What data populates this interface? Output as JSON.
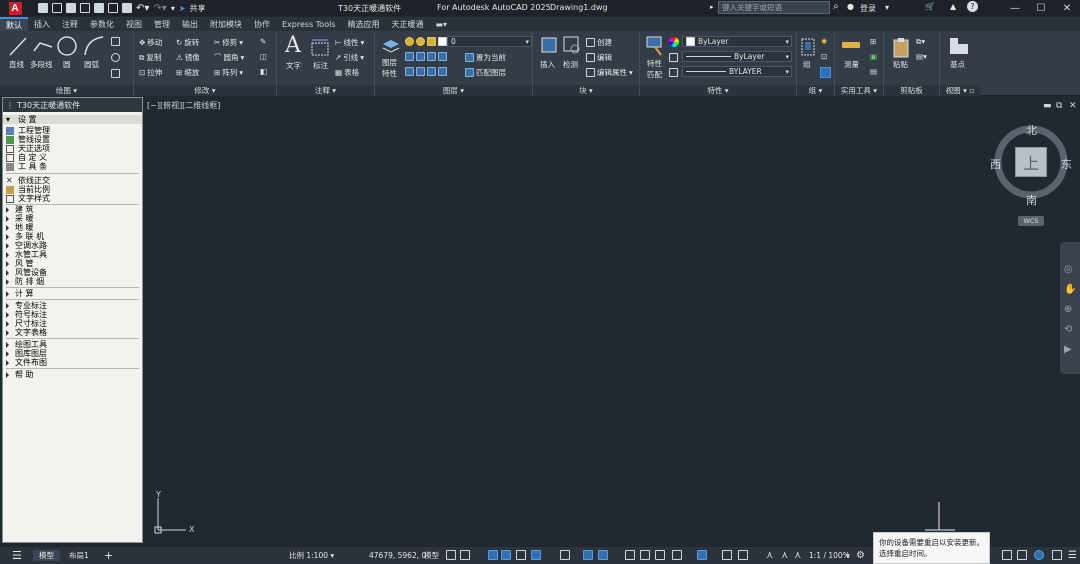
{
  "title_bar": {
    "app_letter": "A",
    "share_label": "共享",
    "doc_title": "T30天正暖通软件",
    "product": "For Autodesk AutoCAD 2025",
    "file": "Drawing1.dwg",
    "search_placeholder": "键入关键字或短语",
    "login": "登录"
  },
  "menu_tabs": [
    "默认",
    "插入",
    "注释",
    "参数化",
    "视图",
    "管理",
    "输出",
    "附加模块",
    "协作",
    "Express Tools",
    "精选应用",
    "天正暖通"
  ],
  "ribbon": {
    "draw": {
      "label": "绘图",
      "line": "直线",
      "polyline": "多段线",
      "circle": "圆",
      "arc": "圆弧"
    },
    "modify": {
      "label": "修改",
      "move": "移动",
      "rotate": "旋转",
      "trim": "修剪",
      "copy": "复制",
      "mirror": "镜像",
      "fillet": "圆角",
      "stretch": "拉伸",
      "scale": "缩放",
      "array": "阵列"
    },
    "annotation": {
      "label": "注释",
      "text": "文字",
      "dimension": "标注",
      "linear": "线性",
      "leader": "引线",
      "table": "表格"
    },
    "layers": {
      "label": "图层",
      "props": "图层\n特性",
      "current_layer": "0",
      "set_current": "置为当前",
      "match_layer": "匹配图层"
    },
    "block": {
      "label": "块",
      "insert": "插入",
      "edit": "检测",
      "create": "创建",
      "edit2": "编辑",
      "edit_attr": "编辑属性"
    },
    "properties": {
      "label": "特性",
      "match": "特性\n匹配",
      "color": "ByLayer",
      "linetype": "ByLayer",
      "lineweight": "BYLAYER"
    },
    "groups": {
      "label": "组",
      "group": "组"
    },
    "utilities": {
      "label": "实用工具",
      "measure": "测量"
    },
    "clipboard": {
      "label": "剪贴板",
      "paste": "粘贴"
    },
    "view": {
      "label": "视图",
      "base": "基点"
    }
  },
  "left_panel": {
    "title": "T30天正暖通软件",
    "sections": [
      {
        "head": "设    置",
        "items": [
          "工程管理",
          "管线设置",
          "天正选项",
          "自 定 义",
          "工 具 条"
        ]
      },
      {
        "head": null,
        "items": [
          "依线正交",
          "当前比例",
          "文字样式"
        ]
      },
      {
        "head": null,
        "items": [
          "建     筑",
          "采     暖",
          "地     暖",
          "多 联 机",
          "空调水路",
          "水管工具",
          "风     管",
          "风管设备",
          "防 排 烟"
        ]
      },
      {
        "head": null,
        "items": [
          "计     算"
        ]
      },
      {
        "head": null,
        "items": [
          "专业标注",
          "符号标注",
          "尺寸标注",
          "文字表格"
        ]
      },
      {
        "head": null,
        "items": [
          "绘图工具",
          "图库图层",
          "文件布图"
        ]
      },
      {
        "head": null,
        "items": [
          "帮     助"
        ]
      }
    ]
  },
  "viewport_label": "[−][俯视][二维线框]",
  "viewcube": {
    "north": "北",
    "south": "南",
    "east": "东",
    "west": "西",
    "top": "上",
    "wcs": "WCS"
  },
  "status": {
    "model_tab": "模型",
    "layout_tab": "布局1",
    "add": "+",
    "scale": "比例 1:100",
    "coords": "47679, 5962, 0",
    "model": "模型",
    "annoscale": "1:1 / 100%"
  },
  "toast": {
    "line1": "你的设备需要重启以安装更新。",
    "line2": "选择重启时间。"
  }
}
